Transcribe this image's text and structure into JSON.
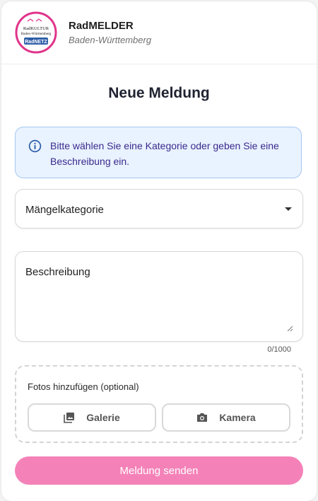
{
  "header": {
    "app_name": "RadMELDER",
    "region": "Baden-Württemberg",
    "logo": {
      "line1": "RadKULTUR",
      "line2": "Baden-Württemberg",
      "banner": "RadNETZ"
    }
  },
  "form": {
    "title": "Neue Meldung",
    "info_message": "Bitte wählen Sie eine Kategorie oder geben Sie eine Beschreibung ein.",
    "category_label": "Mängelkategorie",
    "description_label": "Beschreibung",
    "char_counter": "0/1000",
    "photos_label": "Fotos hinzufügen (optional)",
    "gallery_button": "Galerie",
    "camera_button": "Kamera",
    "submit_button": "Meldung senden"
  },
  "colors": {
    "accent": "#f482b8",
    "info_bg": "#e9f2ff",
    "info_border": "#a6c8ef",
    "logo_ring": "#e0348a",
    "logo_banner": "#2f5fa8"
  },
  "icons": [
    "info-icon",
    "chevron-down-icon",
    "gallery-icon",
    "camera-icon",
    "resize-handle-icon"
  ]
}
